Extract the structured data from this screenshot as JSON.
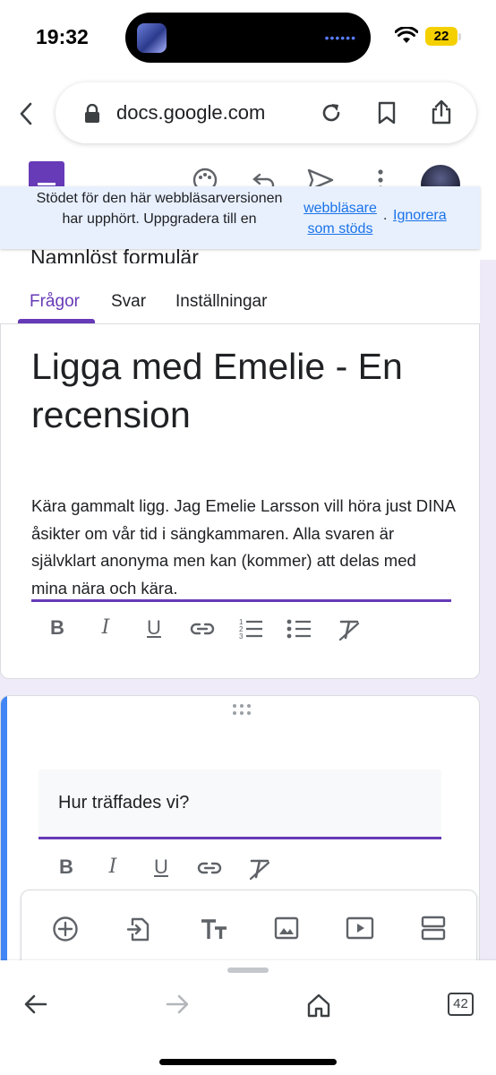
{
  "status": {
    "time": "19:32",
    "battery": "22",
    "island_dots": "••••••"
  },
  "browser": {
    "url": "docs.google.com",
    "tab_count": "42"
  },
  "banner": {
    "message": "Stödet för den här webbläsarversionen har upphört. Uppgradera till en",
    "link": "webbläsare som stöds",
    "dot": ".",
    "dismiss": "Ignorera"
  },
  "form": {
    "doc_title": "Namnlöst formulär",
    "tabs": [
      "Frågor",
      "Svar",
      "Inställningar"
    ],
    "title": "Ligga med Emelie - En recension",
    "description": "Kära gammalt ligg. Jag Emelie Larsson vill höra just DINA åsikter om vår tid i sängkammaren. Alla svaren är självklart anonyma men kan (kommer) att delas med mina nära och kära.",
    "question": "Hur träffades vi?"
  },
  "format_labels": {
    "bold": "B",
    "italic": "I",
    "underline": "U"
  },
  "accent_colors": {
    "forms_purple": "#673ab7",
    "card_accent": "#4285f4",
    "link_blue": "#1a73e8"
  }
}
